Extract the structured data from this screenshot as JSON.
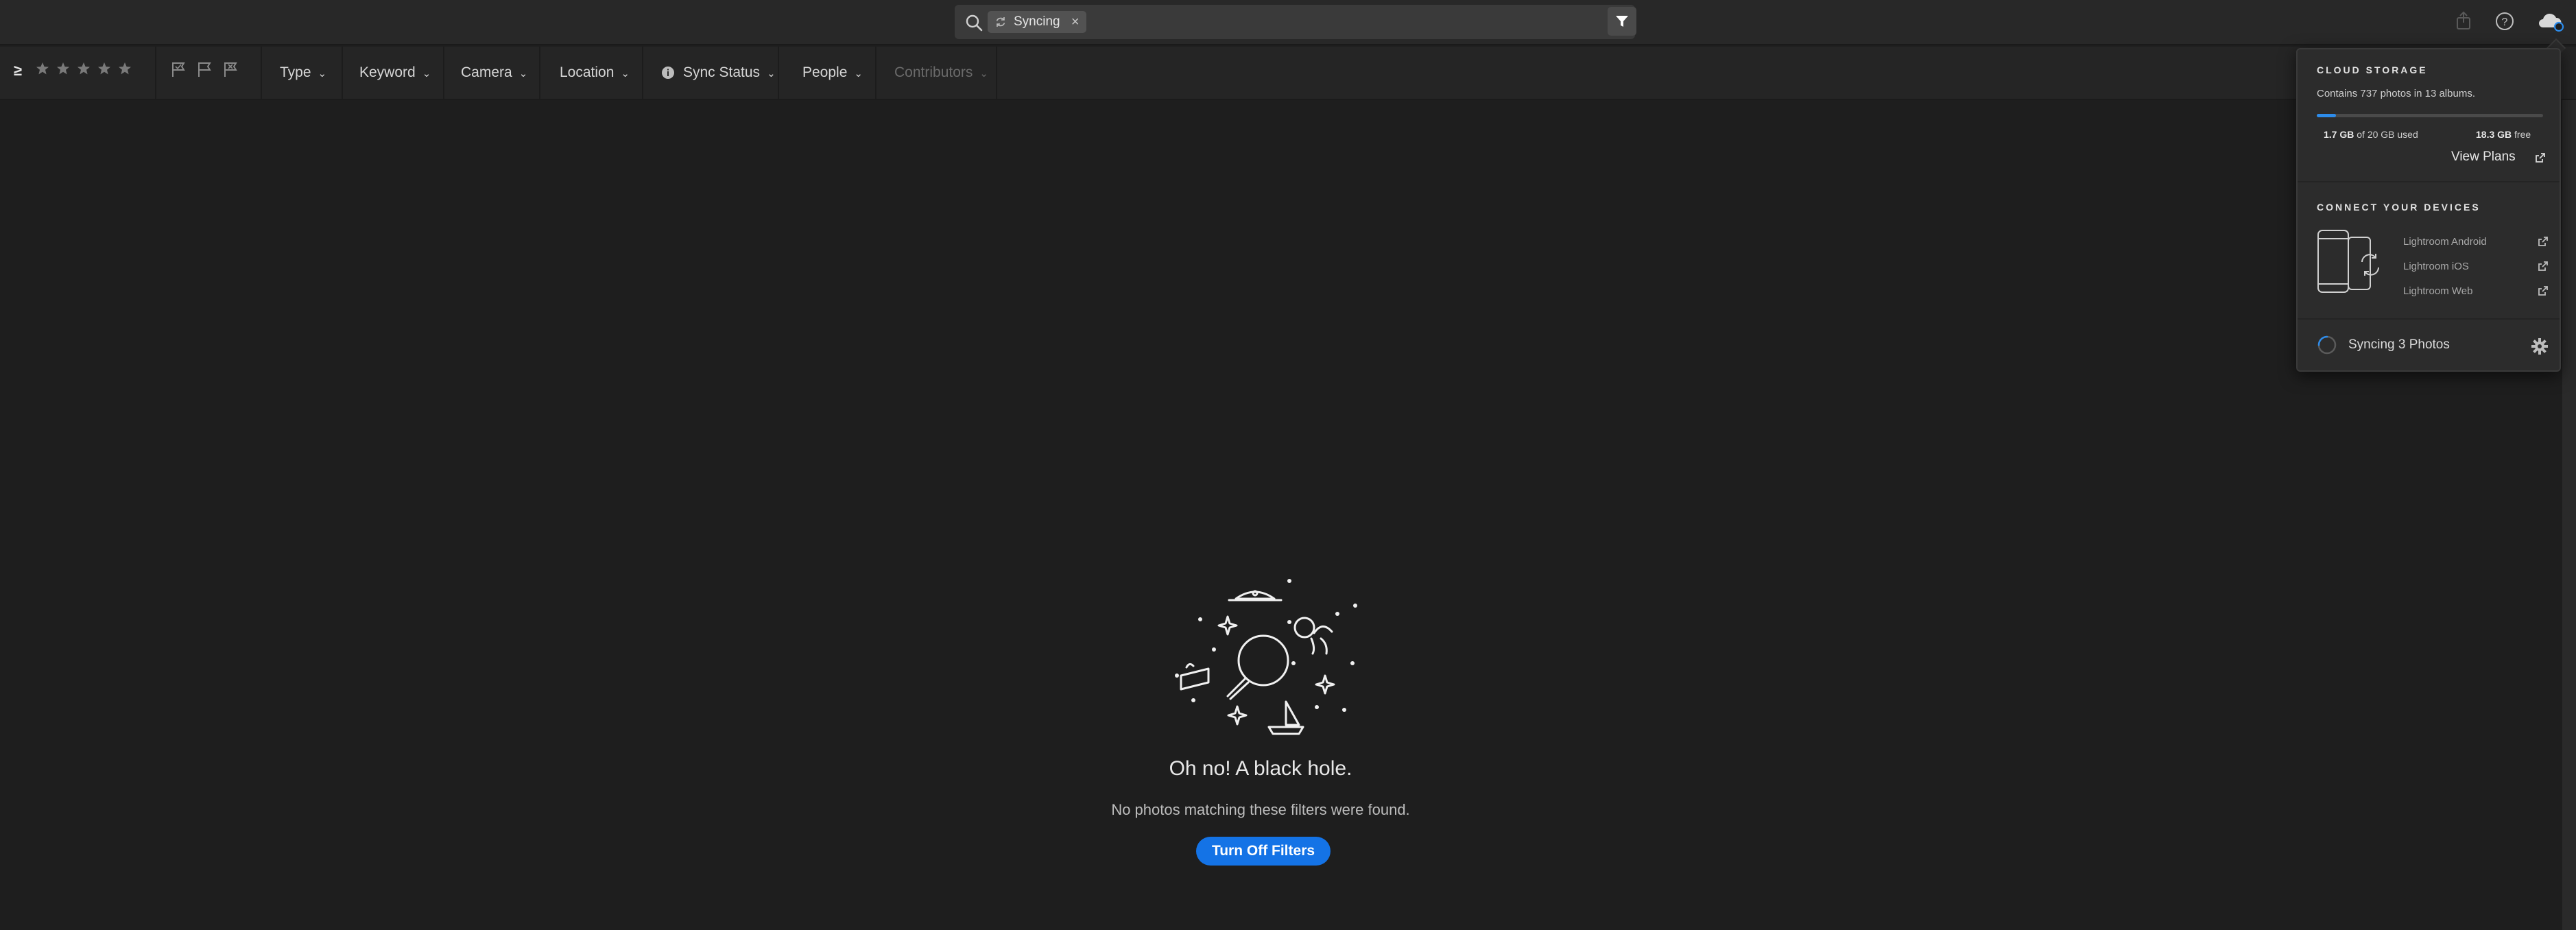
{
  "search": {
    "chip_label": "Syncing",
    "chip_remove": "×",
    "clear": "×"
  },
  "filterbar": {
    "rating_operator": "≥",
    "items": [
      {
        "label": "Type"
      },
      {
        "label": "Keyword"
      },
      {
        "label": "Camera"
      },
      {
        "label": "Location"
      },
      {
        "label": "Sync Status"
      },
      {
        "label": "People"
      },
      {
        "label": "Contributors",
        "disabled": true
      }
    ]
  },
  "empty_state": {
    "title": "Oh no! A black hole.",
    "subtitle": "No photos matching these filters were found.",
    "button": "Turn Off Filters"
  },
  "cloud": {
    "section_title": "CLOUD STORAGE",
    "summary": "Contains 737 photos in 13 albums.",
    "used_amount": "1.7 GB",
    "used_suffix": "of 20 GB used",
    "free_amount": "18.3 GB",
    "free_suffix": "free",
    "used_fraction": 0.085,
    "view_plans": "View Plans"
  },
  "devices": {
    "section_title": "CONNECT YOUR DEVICES",
    "links": [
      "Lightroom Android",
      "Lightroom iOS",
      "Lightroom Web"
    ]
  },
  "sync": {
    "status": "Syncing 3 Photos"
  },
  "colors": {
    "accent": "#1473e6",
    "progress": "#2d8ceb"
  }
}
